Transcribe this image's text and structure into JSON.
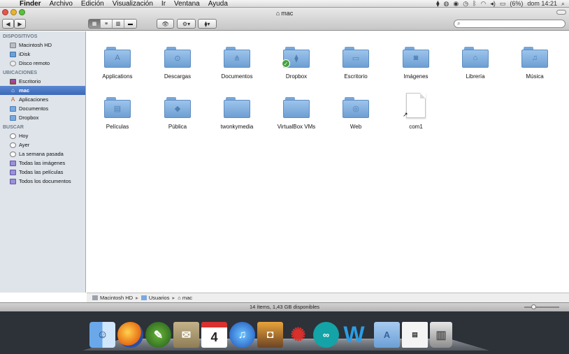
{
  "menubar": {
    "app": "Finder",
    "menus": [
      "Archivo",
      "Edición",
      "Visualización",
      "Ir",
      "Ventana",
      "Ayuda"
    ],
    "battery": "(6%)",
    "clock": "dom 14:21"
  },
  "window": {
    "title": "mac",
    "toolbar": {
      "back_label": "◀",
      "forward_label": "▶",
      "quicklook_label": "👁",
      "action_label": "⚙▾",
      "dropbox_label": "⧫▾",
      "search_placeholder": ""
    },
    "view_modes": [
      "▦",
      "≡",
      "▥",
      "▬"
    ]
  },
  "sidebar": {
    "sections": [
      {
        "title": "DISPOSITIVOS",
        "items": [
          {
            "label": "Macintosh HD",
            "icon": "disk"
          },
          {
            "label": "iDisk",
            "icon": "blue"
          },
          {
            "label": "Disco remoto",
            "icon": "round"
          }
        ]
      },
      {
        "title": "UBICACIONES",
        "items": [
          {
            "label": "Escritorio",
            "icon": "desk"
          },
          {
            "label": "mac",
            "icon": "home",
            "selected": true
          },
          {
            "label": "Aplicaciones",
            "icon": "app"
          },
          {
            "label": "Documentos",
            "icon": "folder"
          },
          {
            "label": "Dropbox",
            "icon": "folder"
          }
        ]
      },
      {
        "title": "BUSCAR",
        "items": [
          {
            "label": "Hoy",
            "icon": "clock"
          },
          {
            "label": "Ayer",
            "icon": "clock"
          },
          {
            "label": "La semana pasada",
            "icon": "clock"
          },
          {
            "label": "Todas las imágenes",
            "icon": "smart"
          },
          {
            "label": "Todas las películas",
            "icon": "smart"
          },
          {
            "label": "Todos los documentos",
            "icon": "smart"
          }
        ]
      }
    ]
  },
  "content": {
    "items": [
      {
        "label": "Applications",
        "type": "folder",
        "emblem": "A"
      },
      {
        "label": "Descargas",
        "type": "folder",
        "emblem": "⊙"
      },
      {
        "label": "Documentos",
        "type": "folder",
        "emblem": "⋔"
      },
      {
        "label": "Dropbox",
        "type": "folder",
        "emblem": "⧫",
        "badge": true
      },
      {
        "label": "Escritorio",
        "type": "folder",
        "emblem": "▭"
      },
      {
        "label": "Imágenes",
        "type": "folder",
        "emblem": "◙"
      },
      {
        "label": "Librería",
        "type": "folder",
        "emblem": "⌂"
      },
      {
        "label": "Música",
        "type": "folder",
        "emblem": "♫"
      },
      {
        "label": "Películas",
        "type": "folder",
        "emblem": "▤"
      },
      {
        "label": "Pública",
        "type": "folder",
        "emblem": "◆"
      },
      {
        "label": "twonkymedia",
        "type": "folder",
        "emblem": ""
      },
      {
        "label": "VirtualBox VMs",
        "type": "folder",
        "emblem": ""
      },
      {
        "label": "Web",
        "type": "folder",
        "emblem": "◎"
      },
      {
        "label": "com1",
        "type": "doc",
        "emblem": ""
      }
    ]
  },
  "pathbar": {
    "segments": [
      "Macintosh HD",
      "Usuarios",
      "mac"
    ]
  },
  "status": {
    "text": "14 ítems, 1,43 GB disponibles"
  },
  "dock": {
    "apps": [
      {
        "name": "finder",
        "glyph": "☺"
      },
      {
        "name": "firefox",
        "glyph": ""
      },
      {
        "name": "gnu",
        "glyph": "✎"
      },
      {
        "name": "mail",
        "glyph": "✉"
      },
      {
        "name": "cal",
        "glyph": "4"
      },
      {
        "name": "itunes",
        "glyph": "♫"
      },
      {
        "name": "iphoto",
        "glyph": "◘"
      },
      {
        "name": "red",
        "glyph": "✺"
      },
      {
        "name": "arduino",
        "glyph": "∞"
      },
      {
        "name": "w",
        "glyph": "W"
      },
      {
        "name": "sep",
        "glyph": ""
      },
      {
        "name": "apps",
        "glyph": "A"
      },
      {
        "name": "screen",
        "glyph": "▤"
      },
      {
        "name": "trash",
        "glyph": "▥"
      }
    ]
  }
}
